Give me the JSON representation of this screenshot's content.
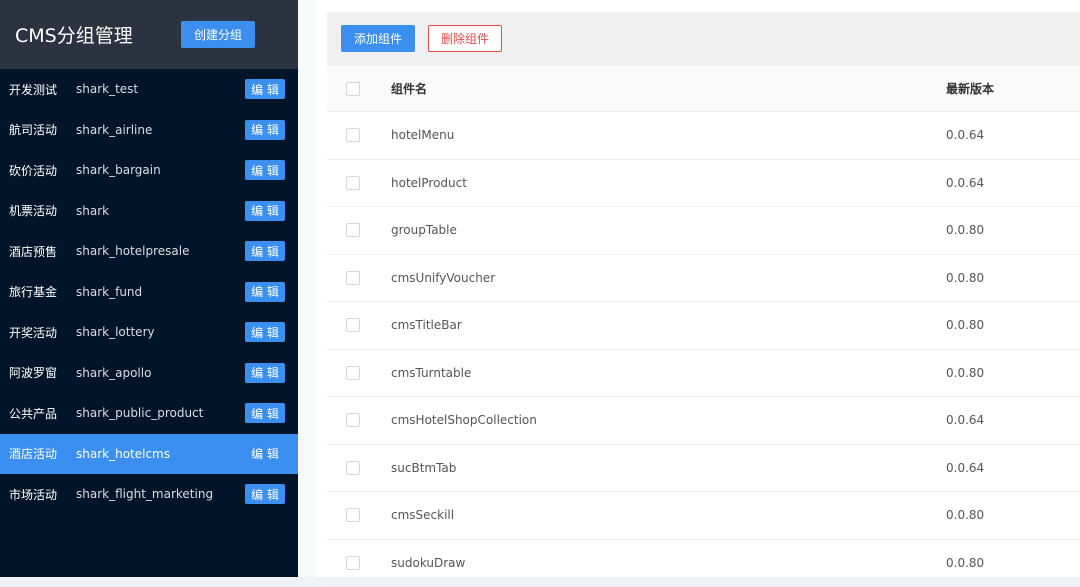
{
  "sidebar": {
    "title": "CMS分组管理",
    "create_label": "创建分组",
    "edit_label": "编 辑",
    "groups": [
      {
        "name": "开发测试",
        "key": "shark_test",
        "active": false
      },
      {
        "name": "航司活动",
        "key": "shark_airline",
        "active": false
      },
      {
        "name": "砍价活动",
        "key": "shark_bargain",
        "active": false
      },
      {
        "name": "机票活动",
        "key": "shark",
        "active": false
      },
      {
        "name": "酒店预售",
        "key": "shark_hotelpresale",
        "active": false
      },
      {
        "name": "旅行基金",
        "key": "shark_fund",
        "active": false
      },
      {
        "name": "开奖活动",
        "key": "shark_lottery",
        "active": false
      },
      {
        "name": "阿波罗窗",
        "key": "shark_apollo",
        "active": false
      },
      {
        "name": "公共产品",
        "key": "shark_public_product",
        "active": false
      },
      {
        "name": "酒店活动",
        "key": "shark_hotelcms",
        "active": true
      },
      {
        "name": "市场活动",
        "key": "shark_flight_marketing",
        "active": false
      }
    ]
  },
  "toolbar": {
    "add_label": "添加组件",
    "delete_label": "删除组件"
  },
  "table": {
    "columns": [
      "组件名",
      "最新版本"
    ],
    "rows": [
      {
        "name": "hotelMenu",
        "version": "0.0.64"
      },
      {
        "name": "hotelProduct",
        "version": "0.0.64"
      },
      {
        "name": "groupTable",
        "version": "0.0.80"
      },
      {
        "name": "cmsUnifyVoucher",
        "version": "0.0.80"
      },
      {
        "name": "cmsTitleBar",
        "version": "0.0.80"
      },
      {
        "name": "cmsTurntable",
        "version": "0.0.80"
      },
      {
        "name": "cmsHotelShopCollection",
        "version": "0.0.64"
      },
      {
        "name": "sucBtmTab",
        "version": "0.0.64"
      },
      {
        "name": "cmsSeckill",
        "version": "0.0.80"
      },
      {
        "name": "sudokuDraw",
        "version": "0.0.80"
      }
    ]
  },
  "colors": {
    "sidebar_bg": "#001529",
    "accent": "#3b8ff0",
    "danger": "#e64b4b"
  }
}
